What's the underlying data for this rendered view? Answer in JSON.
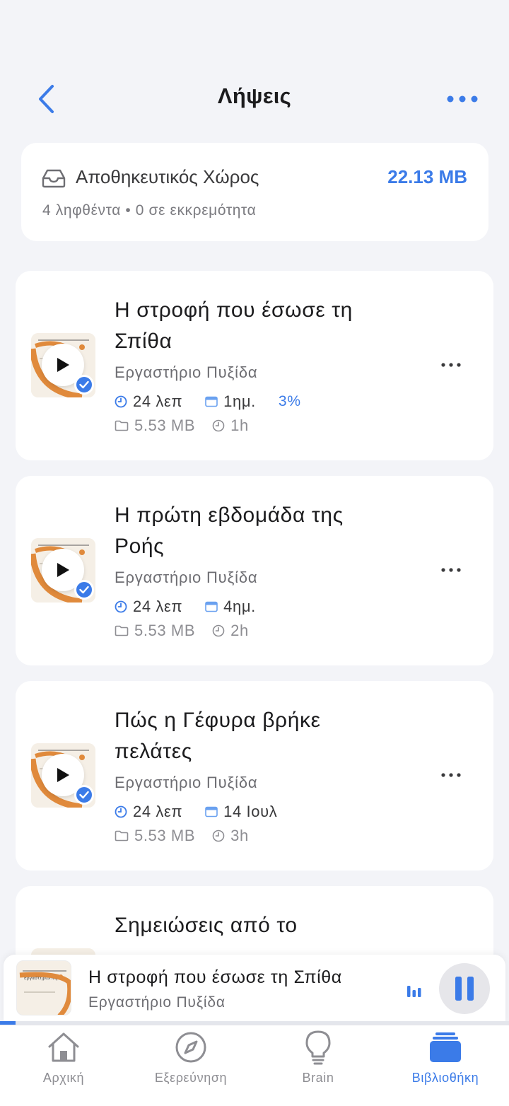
{
  "header": {
    "title": "Λήψεις",
    "back_icon": "chevron-left-icon",
    "more_icon": "ellipsis-icon"
  },
  "storage": {
    "label": "Αποθηκευτικός Χώρος",
    "size": "22.13 MB",
    "summary": "4 ληφθέντα • 0 σε εκκρεμότητα",
    "icon": "inbox-tray-icon"
  },
  "episodes": [
    {
      "title": "Η στροφή που έσωσε τη Σπίθα",
      "author": "Εργαστήριο Πυξίδα",
      "duration": "24 λεπ",
      "date": "1ημ.",
      "progress": "3%",
      "file_size": "5.53 MB",
      "downloaded_ago": "1h",
      "downloaded": true
    },
    {
      "title": "Η πρώτη εβδομάδα της Ροής",
      "author": "Εργαστήριο Πυξίδα",
      "duration": "24 λεπ",
      "date": "4ημ.",
      "progress": "",
      "file_size": "5.53 MB",
      "downloaded_ago": "2h",
      "downloaded": true
    },
    {
      "title": "Πώς η Γέφυρα βρήκε πελάτες",
      "author": "Εργαστήριο Πυξίδα",
      "duration": "24 λεπ",
      "date": "14 Ιουλ",
      "progress": "",
      "file_size": "5.53 MB",
      "downloaded_ago": "3h",
      "downloaded": true
    },
    {
      "title": "Σημειώσεις από το",
      "author": "",
      "duration": "",
      "date": "",
      "progress": "",
      "file_size": "",
      "downloaded_ago": "",
      "downloaded": true
    }
  ],
  "mini_player": {
    "title": "Η στροφή που έσωσε τη Σπίθα",
    "author": "Εργαστήριο Πυξίδα",
    "state": "playing",
    "progress_fraction": 0.03
  },
  "tabs": [
    {
      "label": "Αρχική",
      "icon": "home-icon",
      "active": false
    },
    {
      "label": "Εξερεύνηση",
      "icon": "compass-icon",
      "active": false
    },
    {
      "label": "Brain",
      "icon": "lightbulb-icon",
      "active": false
    },
    {
      "label": "Βιβλιοθήκη",
      "icon": "library-stack-icon",
      "active": true
    }
  ],
  "colors": {
    "accent": "#3b7be8",
    "background": "#f3f4f8",
    "card": "#ffffff",
    "art_orange": "#e08a3c"
  }
}
